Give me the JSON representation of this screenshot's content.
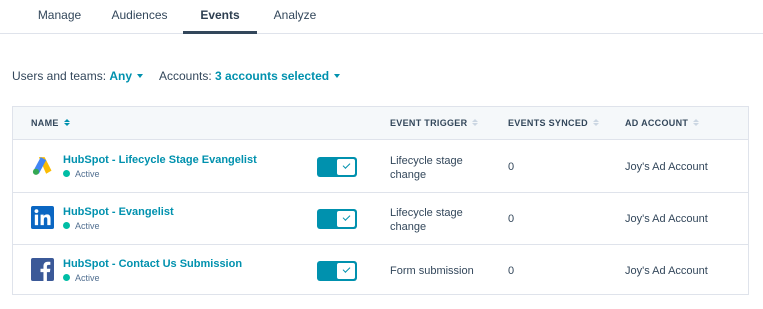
{
  "tabs": [
    {
      "label": "Manage"
    },
    {
      "label": "Audiences"
    },
    {
      "label": "Events",
      "active": true
    },
    {
      "label": "Analyze"
    }
  ],
  "filters": {
    "users_label": "Users and teams:",
    "users_value": "Any",
    "accounts_label": "Accounts:",
    "accounts_value": "3 accounts selected"
  },
  "table": {
    "columns": [
      "NAME",
      "EVENT TRIGGER",
      "EVENTS SYNCED",
      "AD ACCOUNT"
    ],
    "rows": [
      {
        "network_icon": "google-ads-icon",
        "name": "HubSpot - Lifecycle Stage Evangelist",
        "status": "Active",
        "enabled": true,
        "trigger_line1": "Lifecycle stage",
        "trigger_line2": "change",
        "events_synced": "0",
        "ad_account": "Joy's Ad Account"
      },
      {
        "network_icon": "linkedin-icon",
        "name": "HubSpot - Evangelist",
        "status": "Active",
        "enabled": true,
        "trigger_line1": "Lifecycle stage",
        "trigger_line2": "change",
        "events_synced": "0",
        "ad_account": "Joy's Ad Account"
      },
      {
        "network_icon": "facebook-icon",
        "name": "HubSpot - Contact Us Submission",
        "status": "Active",
        "enabled": true,
        "trigger_line1": "Form submission",
        "trigger_line2": "",
        "events_synced": "0",
        "ad_account": "Joy's Ad Account"
      }
    ]
  },
  "colors": {
    "accent": "#0091ae",
    "status_active": "#00bda5",
    "text": "#33475b",
    "header_bg": "#f5f8fa",
    "border": "#dfe3eb"
  }
}
